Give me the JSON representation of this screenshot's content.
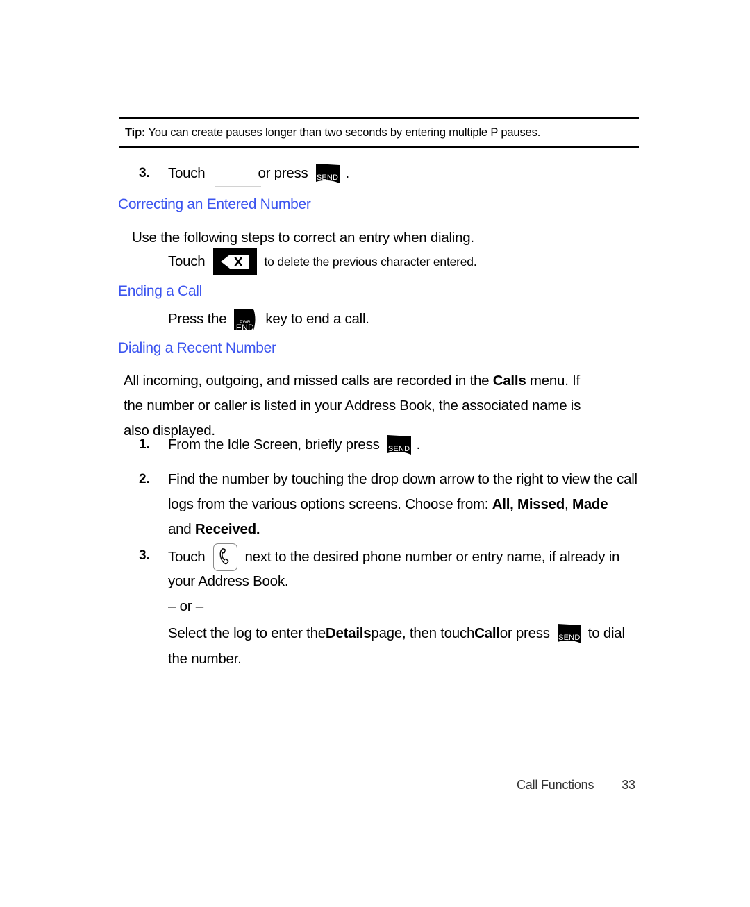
{
  "tip": {
    "label": "Tip:",
    "text": " You can create pauses longer than two seconds by entering multiple P pauses."
  },
  "steps_top": {
    "number": "3.",
    "touch_label": "Touch",
    "or_press_label": "or press",
    "period": "."
  },
  "sections": [
    {
      "heading": "Correcting an Entered Number",
      "intro": "Use the following steps to correct an entry when dialing.",
      "touch_label": "Touch",
      "after_icon": "to delete the previous character entered."
    },
    {
      "heading": "Ending a Call",
      "press_label": "Press the",
      "after_icon": "key to end a call."
    },
    {
      "heading": "Dialing a Recent Number"
    }
  ],
  "recent": {
    "para_a": "All incoming, outgoing, and missed calls are recorded in the ",
    "para_a_bold": "Calls",
    "para_b": " menu. If",
    "para_c": "the number or caller is listed in your Address Book, the associated name is",
    "para_d": "also displayed.",
    "step1": {
      "number": "1.",
      "text_before": "From the Idle Screen, briefly press",
      "text_after": "."
    },
    "step2": {
      "number": "2.",
      "line1": "Find the number by touching the drop down arrow to the right to view the call",
      "line2_a": "logs from the various options screens. Choose from: ",
      "line2_bold1": "All, Missed",
      "line2_mid": ", ",
      "line2_bold2": "Made",
      "line3_a": "and ",
      "line3_bold": "Received."
    },
    "step3": {
      "number": "3.",
      "touch_label": "Touch",
      "line1_after": "next to the desired phone number or entry name, if already in",
      "line2": "your Address Book.",
      "or_divider": "– or –",
      "final_a": "Select the log to enter the ",
      "final_bold1": "Details",
      "final_b": " page, then touch ",
      "final_bold2": "Call",
      "final_c": " or press",
      "final_d": "to dial",
      "final_line2": "the number."
    }
  },
  "icons": {
    "send": "send-key-icon",
    "end": "end-key-icon",
    "backspace": "backspace-icon",
    "phone": "phone-handset-icon",
    "send_label": "SEND",
    "end_label": "END",
    "pwr_label": "PWR"
  },
  "footer": {
    "chapter": "Call Functions",
    "page": "33"
  },
  "colors": {
    "heading_blue": "#3b54ef",
    "rule_black": "#000000",
    "key_black": "#000000"
  }
}
